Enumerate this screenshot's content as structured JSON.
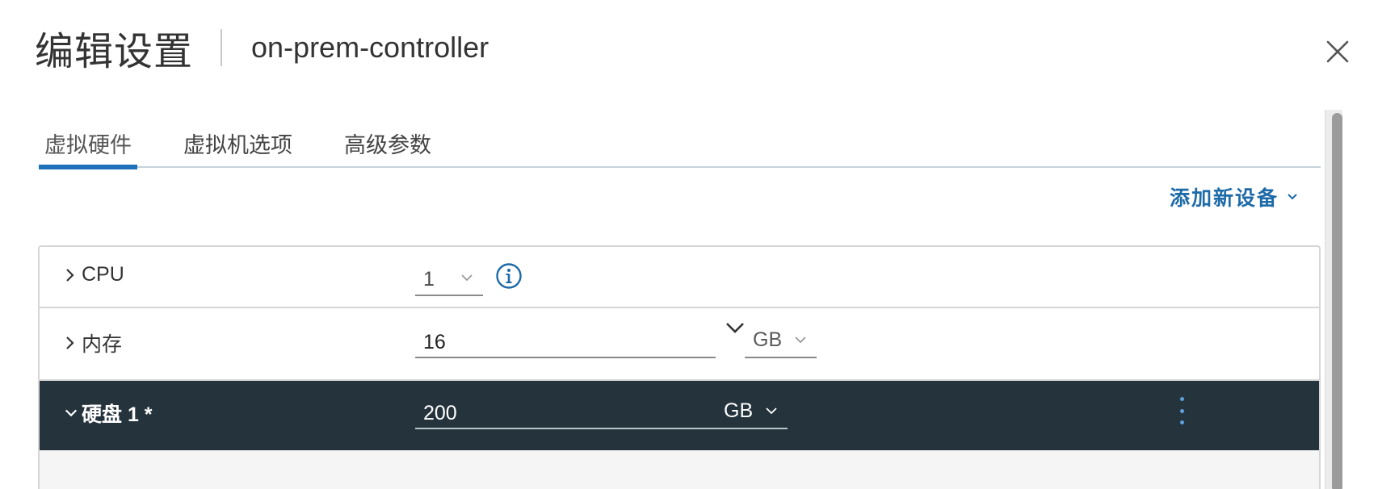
{
  "dialog": {
    "title": "编辑设置",
    "subtitle": "on-prem-controller"
  },
  "tabs": [
    {
      "label": "虚拟硬件",
      "active": true
    },
    {
      "label": "虚拟机选项",
      "active": false
    },
    {
      "label": "高级参数",
      "active": false
    }
  ],
  "toolbar": {
    "add_device_label": "添加新设备"
  },
  "hardware": {
    "cpu": {
      "label": "CPU",
      "value": "1"
    },
    "memory": {
      "label": "内存",
      "value": "16",
      "unit": "GB"
    },
    "disk": {
      "label": "硬盘 1 *",
      "value": "200",
      "unit": "GB"
    }
  },
  "colors": {
    "accent": "#1e70b8",
    "link": "#1d6aa8",
    "selected_row_bg": "#25333c",
    "kebab": "#5fa0db"
  },
  "icons": {
    "close": "close-icon",
    "info": "info-icon",
    "chevron": "chevron-down-icon",
    "expand": "chevron-right-icon",
    "more": "more-vertical-icon"
  }
}
